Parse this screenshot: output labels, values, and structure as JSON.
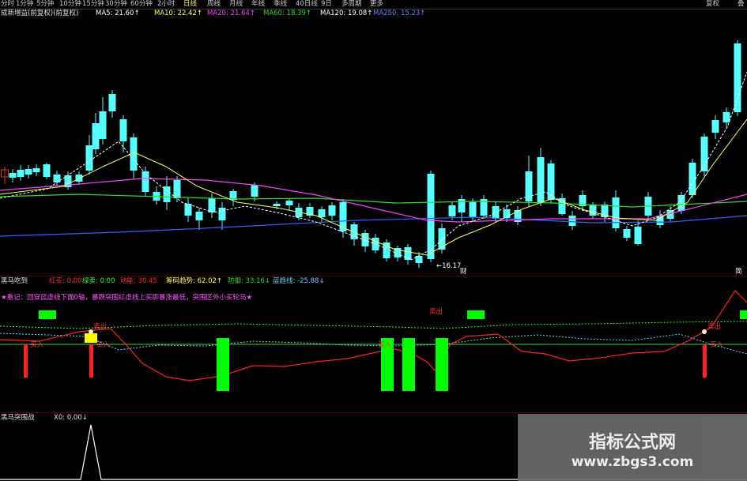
{
  "colors": {
    "up": "#e03030",
    "down": "#54ffff",
    "ma5": "#ffffff",
    "ma10": "#ffff55",
    "ma20": "#ff40ff",
    "ma60": "#30dd30",
    "ma120": "#ffffff",
    "ma250": "#3060ff",
    "red": "#ff2020",
    "green": "#00ff00",
    "yellow": "#ffff00",
    "pink": "#ff55ff"
  },
  "toolbar": {
    "periods": [
      "分时",
      "1分钟",
      "5分钟",
      "10分钟",
      "15分钟",
      "30分钟",
      "60分钟",
      "2小时",
      "日线",
      "周线",
      "月线",
      "年线",
      "季线",
      "40日线",
      "9日",
      "多周期",
      "更多"
    ],
    "restore": "复权",
    "equal": "叠"
  },
  "main": {
    "title": "成新增益(前复权)(前复权)",
    "ma5": "MA5: 21.60↑",
    "ma10": "MA10: 22.42↑",
    "ma20": "MA20: 21.64↑",
    "ma60": "MA60: 18.39↑",
    "ma120": "MA120: 19.08↑",
    "ma250": "MA250: 15.23↑",
    "low_label": "←16.17",
    "bottom_tag": "财",
    "right_tag": "简"
  },
  "indicator": {
    "name": "黑马吃到",
    "red_label": "红买: 0.00",
    "green_label": "绿卖: 0.00",
    "line_label": "动能: 30.45",
    "trend_label": "筹码趋势: 62.02↑",
    "resist_label": "防御: 33.16↓",
    "blue_label": "蓝趋线: -25.88↓",
    "note": "★重记：回穿蓝虚线下面0轴，暴跌突围红虚线上买即暴涨最低，突围区外小买轮马★",
    "sell_tags": [
      "卖出",
      "卖出",
      "卖出"
    ],
    "buy_tags": [
      "买入",
      "买入",
      "买入",
      "买入"
    ]
  },
  "sub": {
    "name": "黑马突围战",
    "value": "X0: 0.00↓"
  },
  "watermark": {
    "title": "指标公式网",
    "url": "www.zbgs3.com"
  }
}
